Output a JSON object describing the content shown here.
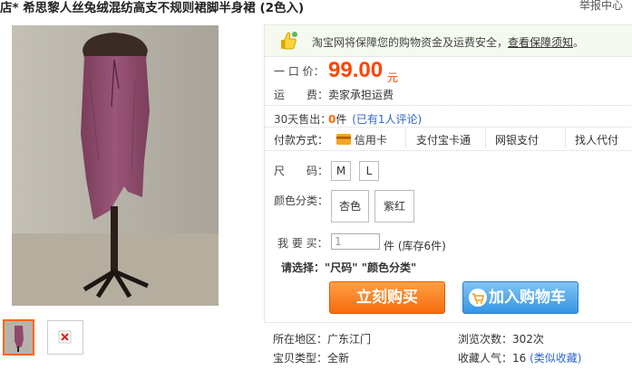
{
  "header": {
    "title": "店* 希思黎人丝兔绒混纺高支不规则裙脚半身裙 (2色入)",
    "report_link": "举报中心"
  },
  "guarantee": {
    "text": "淘宝网将保障您的购物资金及运费安全，",
    "link": "查看保障须知",
    "period": "。",
    "accent": "#f5faf0"
  },
  "price": {
    "label": "一 口 价：",
    "value": "99.00",
    "unit": "元",
    "color": "#ff4400"
  },
  "shipping": {
    "label": "运　　费：",
    "value": "卖家承担运费"
  },
  "sales": {
    "label": "30天售出：",
    "count": "0",
    "unit": "件",
    "review_link": "(已有1人评论)"
  },
  "payment": {
    "label": "付款方式：",
    "methods": [
      "信用卡",
      "支付宝卡通",
      "网银支付",
      "找人代付"
    ]
  },
  "size": {
    "label": "尺　　码：",
    "options": [
      "M",
      "L"
    ]
  },
  "color_opt": {
    "label": "颜色分类：",
    "options": [
      "杏色",
      "紫红"
    ]
  },
  "quantity": {
    "label": "我 要 买：",
    "value": "1",
    "unit": "件",
    "stock": "(库存6件)"
  },
  "prompt": {
    "label": "请选择：",
    "text": "\"尺码\" \"颜色分类\""
  },
  "buttons": {
    "buy": "立刻购买",
    "cart": "加入购物车"
  },
  "details": {
    "location_label": "所在地区：",
    "location": "广东江门",
    "type_label": "宝贝类型：",
    "type": "全新",
    "views_label": "浏览次数：",
    "views": "302次",
    "favs_label": "收藏人气：",
    "favs": "16",
    "similar_link": "(类似收藏)"
  }
}
